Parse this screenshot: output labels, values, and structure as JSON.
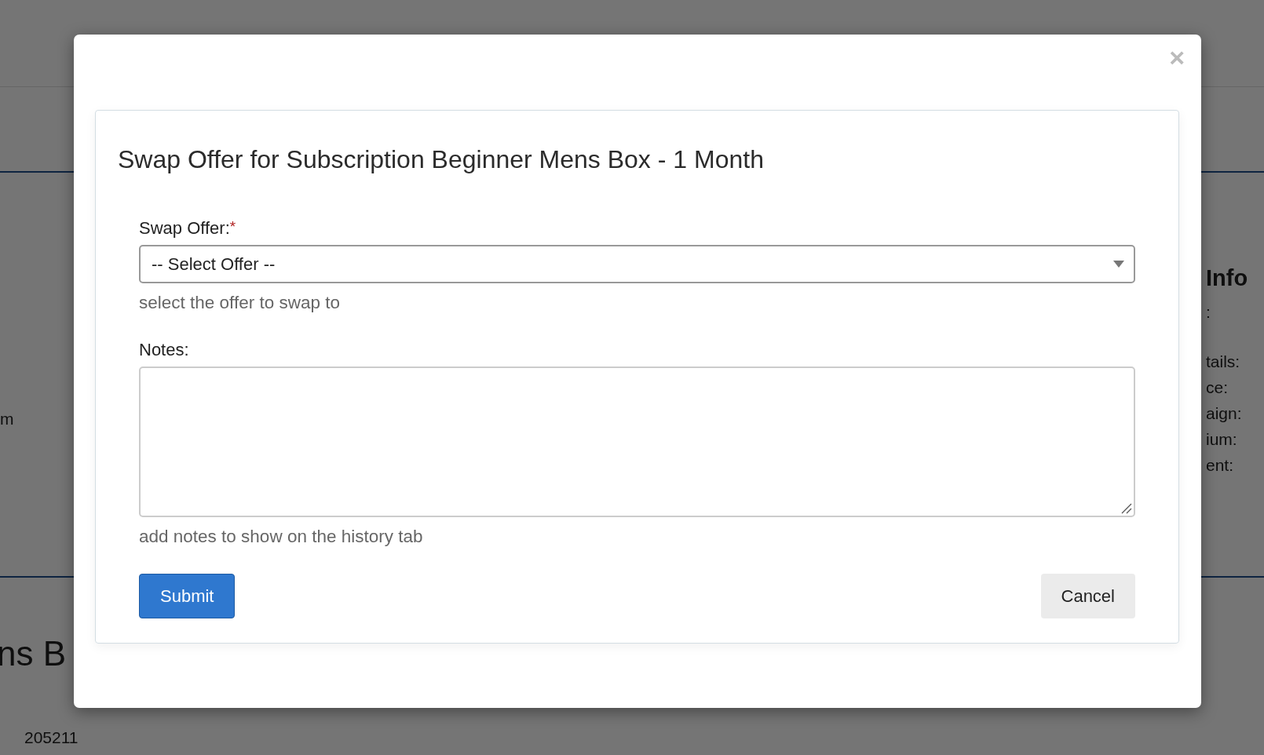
{
  "background": {
    "left_text": "m",
    "heading": "ns B",
    "id_text": "205211",
    "right_panel": {
      "title": "Info",
      "labels": [
        ":",
        "tails:",
        "ce:",
        "aign:",
        "ium:",
        "ent:"
      ]
    }
  },
  "modal": {
    "close": "×",
    "title": "Swap Offer for Subscription Beginner Mens Box - 1 Month",
    "fields": [
      {
        "kind": "select",
        "label": "Swap Offer:",
        "required_mark": "*",
        "value": "-- Select Offer --",
        "help": "select the offer to swap to"
      },
      {
        "kind": "textarea",
        "label": "Notes:",
        "help": "add notes to show on the history tab"
      }
    ],
    "buttons": [
      {
        "label": "Submit",
        "kind": "primary"
      },
      {
        "label": "Cancel",
        "kind": "secondary"
      }
    ]
  }
}
